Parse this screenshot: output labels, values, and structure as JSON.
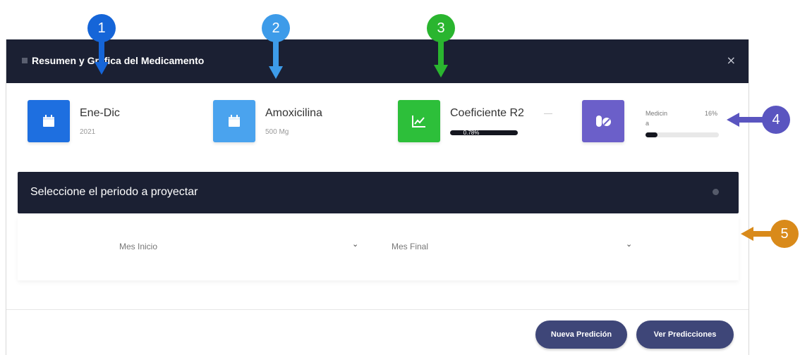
{
  "modal": {
    "title": "Resumen y Grafica del Medicamento",
    "close_label": "×"
  },
  "stats": [
    {
      "title": "Ene-Dic",
      "sub": "2021",
      "icon": "calendar-icon",
      "color": "#1e6fe0"
    },
    {
      "title": "Amoxicilina",
      "sub": "500 Mg",
      "icon": "calendar-icon",
      "color": "#4aa3ee"
    },
    {
      "title": "Coeficiente R2",
      "progress_label": "0.78%",
      "progress_value": 0.78,
      "icon": "trend-chart-icon",
      "color": "#2dbf3a"
    },
    {
      "title": "Medicin",
      "title_line2": "a",
      "percent_label": "16%",
      "progress_value": 0.16,
      "icon": "pills-icon",
      "color": "#6b5fc9"
    }
  ],
  "period": {
    "title": "Seleccione el periodo a proyectar"
  },
  "selects": {
    "start_value": "Mes Inicio",
    "end_value": "Mes Final"
  },
  "buttons": {
    "new_prediction": "Nueva Predición",
    "view_predictions": "Ver Predicciones"
  },
  "callouts": [
    {
      "label": "1",
      "color": "#1565d8"
    },
    {
      "label": "2",
      "color": "#3d9be9"
    },
    {
      "label": "3",
      "color": "#2ab52f"
    },
    {
      "label": "4",
      "color": "#5a55c0"
    },
    {
      "label": "5",
      "color": "#d98a1a"
    }
  ]
}
